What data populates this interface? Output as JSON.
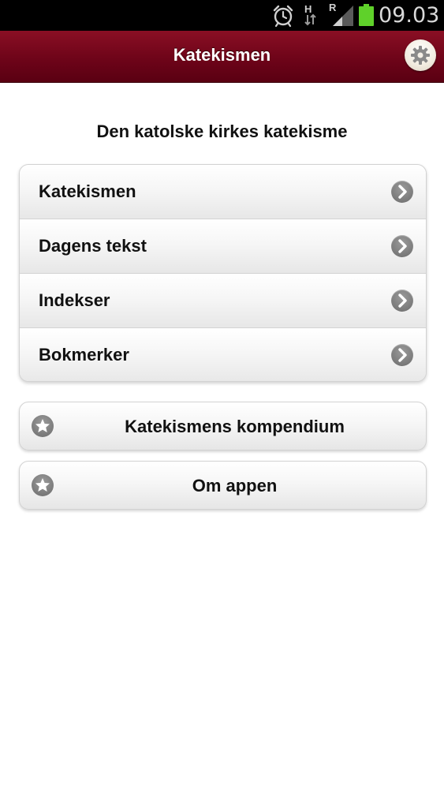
{
  "status_bar": {
    "time": "09.03",
    "network_type": "H",
    "roaming": "R",
    "icons": [
      "alarm-icon",
      "data-arrows-icon",
      "signal-icon",
      "battery-icon"
    ],
    "battery_color": "#5fd12a"
  },
  "header": {
    "title": "Katekismen",
    "background_color": "#6e0419",
    "settings_icon": "gear-icon"
  },
  "main": {
    "heading": "Den katolske kirkes katekisme",
    "menu_items": [
      {
        "label": "Katekismen",
        "icon": "chevron-right-icon"
      },
      {
        "label": "Dagens tekst",
        "icon": "chevron-right-icon"
      },
      {
        "label": "Indekser",
        "icon": "chevron-right-icon"
      },
      {
        "label": "Bokmerker",
        "icon": "chevron-right-icon"
      }
    ],
    "buttons": [
      {
        "label": "Katekismens kompendium",
        "icon": "star-icon"
      },
      {
        "label": "Om appen",
        "icon": "star-icon"
      }
    ]
  }
}
